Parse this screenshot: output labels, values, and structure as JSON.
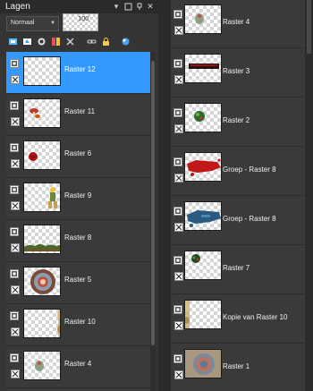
{
  "panel": {
    "title": "Lagen",
    "blend_mode": "Normaal",
    "opacity": "100"
  },
  "colors": {
    "selected": "#3399ff",
    "panel_bg": "#353535",
    "list_bg": "#3a3a3a"
  },
  "left_layers": [
    {
      "name": "Raster 12",
      "selected": true,
      "thumb": "empty"
    },
    {
      "name": "Raster 11",
      "selected": false,
      "thumb": "mushroom"
    },
    {
      "name": "Raster 6",
      "selected": false,
      "thumb": "red-dot"
    },
    {
      "name": "Raster 9",
      "selected": false,
      "thumb": "figure"
    },
    {
      "name": "Raster 8",
      "selected": false,
      "thumb": "grass"
    },
    {
      "name": "Raster 5",
      "selected": false,
      "thumb": "wreath"
    },
    {
      "name": "Raster 10",
      "selected": false,
      "thumb": "corner"
    },
    {
      "name": "Raster 4",
      "selected": false,
      "thumb": "small-object"
    }
  ],
  "right_layers": [
    {
      "name": "Raster 4",
      "thumb": "small-object"
    },
    {
      "name": "Raster 3",
      "thumb": "dark-bar"
    },
    {
      "name": "Raster 2",
      "thumb": "green-ball"
    },
    {
      "name": "Groep - Raster 8",
      "thumb": "red-splash"
    },
    {
      "name": "Groep - Raster 8",
      "thumb": "blue-splash"
    },
    {
      "name": "Raster 7",
      "thumb": "green-cluster"
    },
    {
      "name": "Kopie van Raster 10",
      "thumb": "corner"
    },
    {
      "name": "Raster 1",
      "thumb": "pattern"
    }
  ]
}
